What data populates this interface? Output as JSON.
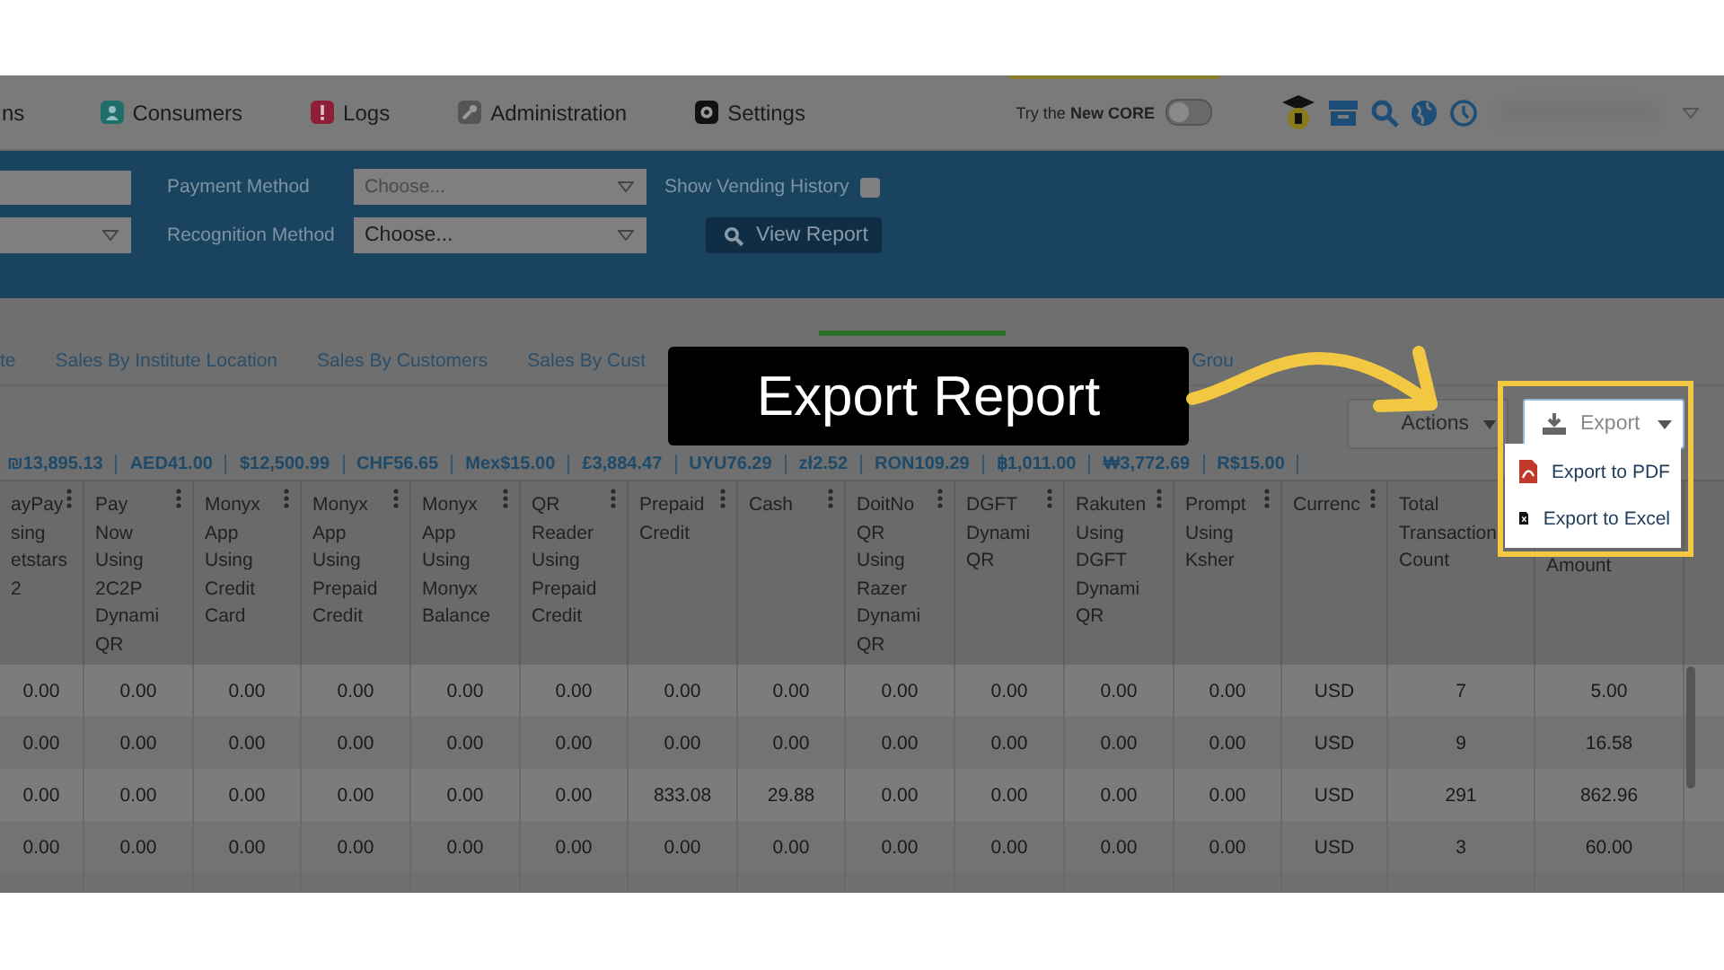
{
  "nav": {
    "items": [
      {
        "label": "ns"
      },
      {
        "label": "Consumers"
      },
      {
        "label": "Logs"
      },
      {
        "label": "Administration"
      },
      {
        "label": "Settings"
      }
    ],
    "core_toggle": {
      "label": "Try the **New** **CORE**",
      "on": false
    }
  },
  "filters": {
    "payment_method": {
      "label": "Payment Method",
      "placeholder": "Choose..."
    },
    "recognition_method": {
      "label": "Recognition Method",
      "value": "Choose..."
    },
    "show_vending_history": {
      "label": "Show Vending History",
      "checked": false
    },
    "view_report_button": "View Report"
  },
  "tabs": [
    {
      "label": "te",
      "selected": false
    },
    {
      "label": "Sales By Institute Location",
      "selected": false
    },
    {
      "label": "Sales By Customers",
      "selected": false
    },
    {
      "label": "Sales By Cust",
      "selected": false
    },
    {
      "selected": true
    },
    {
      "label": "Grou",
      "selected": false
    }
  ],
  "toolbar": {
    "actions_button": "Actions",
    "export_button": "Export",
    "export_menu": [
      {
        "kind": "pdf",
        "label": "Export to PDF"
      },
      {
        "kind": "excel",
        "label": "Export to Excel"
      }
    ]
  },
  "totals": [
    "₪13,895.13",
    "AED41.00",
    "$12,500.99",
    "CHF56.65",
    "Mex$15.00",
    "£3,884.47",
    "UYU76.29",
    "zł2.52",
    "RON109.29",
    "฿1,011.00",
    "₩3,772.69",
    "R$15.00"
  ],
  "table": {
    "columns": [
      "ayPay\nsing\netstars\n2",
      "Pay\nNow\nUsing\n2C2P\nDynami\nQR",
      "Monyx\nApp\nUsing\nCredit\nCard",
      "Monyx\nApp\nUsing\nPrepaid\nCredit",
      "Monyx\nApp\nUsing\nMonyx\nBalance",
      "QR\nReader\nUsing\nPrepaid\nCredit",
      "Prepaid\nCredit",
      "Cash",
      "DoitNo\nQR\nUsing\nRazer\nDynami\nQR",
      "DGFT\nDynami\nQR",
      "Rakuten\nUsing\nDGFT\nDynami\nQR",
      "Prompt\nUsing\nKsher",
      "Currenc",
      "Total\nTransaction\nCount",
      "Amount"
    ],
    "rows": [
      [
        "0.00",
        "0.00",
        "0.00",
        "0.00",
        "0.00",
        "0.00",
        "0.00",
        "0.00",
        "0.00",
        "0.00",
        "0.00",
        "0.00",
        "USD",
        "7",
        "5.00"
      ],
      [
        "0.00",
        "0.00",
        "0.00",
        "0.00",
        "0.00",
        "0.00",
        "0.00",
        "0.00",
        "0.00",
        "0.00",
        "0.00",
        "0.00",
        "USD",
        "9",
        "16.58"
      ],
      [
        "0.00",
        "0.00",
        "0.00",
        "0.00",
        "0.00",
        "0.00",
        "833.08",
        "29.88",
        "0.00",
        "0.00",
        "0.00",
        "0.00",
        "USD",
        "291",
        "862.96"
      ],
      [
        "0.00",
        "0.00",
        "0.00",
        "0.00",
        "0.00",
        "0.00",
        "0.00",
        "0.00",
        "0.00",
        "0.00",
        "0.00",
        "0.00",
        "USD",
        "3",
        "60.00"
      ]
    ]
  },
  "callout": "Export Report"
}
